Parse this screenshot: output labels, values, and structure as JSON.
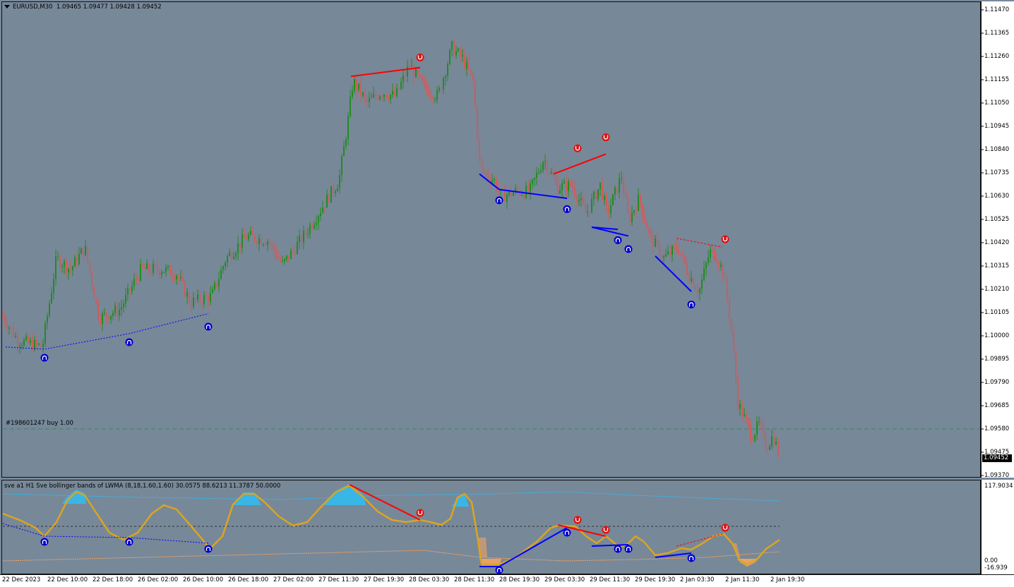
{
  "window": {
    "symbol_label": "EURUSD,M30",
    "ohlc": "1.09465 1.09477 1.09428 1.09452",
    "order_label": "#198601247 buy 1.00",
    "current_price": "1.09452"
  },
  "indicator": {
    "title": "sve a1 H1 Sve bollinger bands of LWMA (8,18,1.60,1.60) 30.0575 88.6213 11.3787 50.0000",
    "axis_labels": [
      "117.9034",
      "0.00",
      "-16.939"
    ]
  },
  "price_axis_labels": [
    "1.11470",
    "1.11365",
    "1.11260",
    "1.11155",
    "1.11050",
    "1.10945",
    "1.10840",
    "1.10735",
    "1.10630",
    "1.10525",
    "1.10420",
    "1.10315",
    "1.10210",
    "1.10105",
    "1.10000",
    "1.09895",
    "1.09790",
    "1.09685",
    "1.09580",
    "1.09475",
    "1.09370"
  ],
  "time_axis_labels": [
    "22 Dec 2023",
    "22 Dec 10:00",
    "22 Dec 18:00",
    "26 Dec 02:00",
    "26 Dec 10:00",
    "26 Dec 18:00",
    "27 Dec 02:00",
    "27 Dec 11:30",
    "27 Dec 19:30",
    "28 Dec 03:30",
    "28 Dec 11:30",
    "28 Dec 19:30",
    "29 Dec 03:30",
    "29 Dec 11:30",
    "29 Dec 19:30",
    "2 Jan 03:30",
    "2 Jan 11:30",
    "2 Jan 19:30"
  ],
  "colors": {
    "background": "#778899",
    "bull": "#228B22",
    "bear": "#CD5C5C",
    "bull_divergence": "#0000FF",
    "bear_divergence": "#FF0000",
    "oscillator": "#DAA520",
    "overbought_fill": "#33BBEE",
    "oversold_fill": "#F4A460",
    "order_line": "#2E8B57",
    "up_signal": "#0000CC",
    "down_signal": "#DD1111"
  },
  "chart_data": {
    "type": "candlestick",
    "title": "EURUSD,M30",
    "ylim": [
      1.0937,
      1.1147
    ],
    "price_path": [
      [
        0,
        1.1011
      ],
      [
        25,
        1.0998
      ],
      [
        60,
        1.0995
      ],
      [
        80,
        1.1035
      ],
      [
        100,
        1.103
      ],
      [
        120,
        1.104
      ],
      [
        140,
        1.1008
      ],
      [
        170,
        1.1012
      ],
      [
        200,
        1.103
      ],
      [
        230,
        1.103
      ],
      [
        250,
        1.1028
      ],
      [
        270,
        1.1015
      ],
      [
        300,
        1.1018
      ],
      [
        320,
        1.1035
      ],
      [
        350,
        1.1045
      ],
      [
        380,
        1.1043
      ],
      [
        400,
        1.1032
      ],
      [
        430,
        1.1045
      ],
      [
        460,
        1.106
      ],
      [
        480,
        1.107
      ],
      [
        492,
        1.1095
      ],
      [
        500,
        1.1115
      ],
      [
        520,
        1.1105
      ],
      [
        540,
        1.111
      ],
      [
        560,
        1.1108
      ],
      [
        580,
        1.1122
      ],
      [
        600,
        1.1112
      ],
      [
        620,
        1.1108
      ],
      [
        640,
        1.113
      ],
      [
        655,
        1.1125
      ],
      [
        670,
        1.1115
      ],
      [
        680,
        1.1075
      ],
      [
        700,
        1.107
      ],
      [
        710,
        1.1063
      ],
      [
        730,
        1.1065
      ],
      [
        750,
        1.1065
      ],
      [
        770,
        1.108
      ],
      [
        790,
        1.1067
      ],
      [
        810,
        1.1068
      ],
      [
        830,
        1.1055
      ],
      [
        850,
        1.1068
      ],
      [
        860,
        1.1055
      ],
      [
        880,
        1.1072
      ],
      [
        890,
        1.1052
      ],
      [
        905,
        1.1062
      ],
      [
        920,
        1.1045
      ],
      [
        940,
        1.1035
      ],
      [
        960,
        1.104
      ],
      [
        975,
        1.1028
      ],
      [
        990,
        1.102
      ],
      [
        1005,
        1.1038
      ],
      [
        1015,
        1.1036
      ],
      [
        1025,
        1.1028
      ],
      [
        1035,
        1.1005
      ],
      [
        1045,
        1.097
      ],
      [
        1055,
        1.0962
      ],
      [
        1065,
        1.0955
      ],
      [
        1075,
        1.096
      ],
      [
        1085,
        1.095
      ],
      [
        1095,
        1.0955
      ],
      [
        1104,
        1.0945
      ]
    ],
    "signals_up": [
      [
        63,
        1.0993
      ],
      [
        183,
        1.1
      ],
      [
        295,
        1.1007
      ],
      [
        707,
        1.1064
      ],
      [
        803,
        1.106
      ],
      [
        875,
        1.1046
      ],
      [
        890,
        1.1042
      ],
      [
        979,
        1.1017
      ]
    ],
    "signals_down": [
      [
        595,
        1.1123
      ],
      [
        818,
        1.1082
      ],
      [
        858,
        1.1087
      ],
      [
        1027,
        1.1041
      ]
    ],
    "order_price": 1.0958,
    "indicator_levels": [
      "117.9034",
      "0.00",
      "-16.939"
    ]
  }
}
